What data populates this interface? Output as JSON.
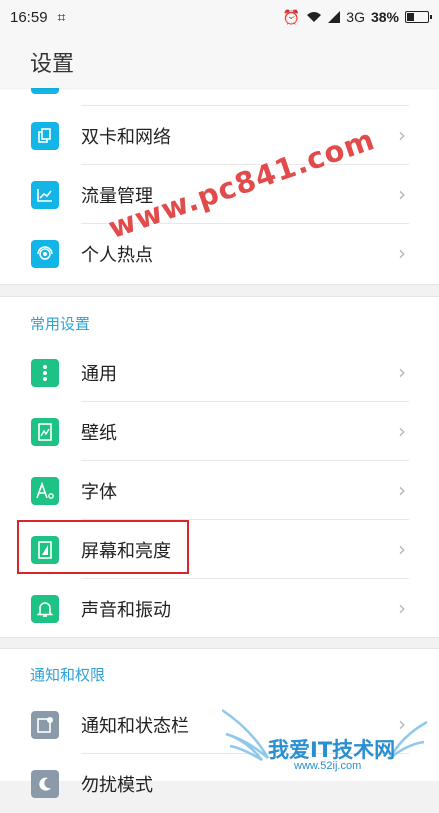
{
  "status_bar": {
    "time": "16:59",
    "network": "3G",
    "battery": "38%",
    "battery_level": 0.38
  },
  "header": {
    "title": "设置"
  },
  "group1": {
    "items": [
      {
        "label": "双卡和网络",
        "icon": "sim-card-icon"
      },
      {
        "label": "流量管理",
        "icon": "chart-icon"
      },
      {
        "label": "个人热点",
        "icon": "hotspot-icon"
      }
    ]
  },
  "group2": {
    "title": "常用设置",
    "items": [
      {
        "label": "通用",
        "icon": "more-vertical-icon"
      },
      {
        "label": "壁纸",
        "icon": "wallpaper-icon"
      },
      {
        "label": "字体",
        "icon": "font-icon"
      },
      {
        "label": "屏幕和亮度",
        "icon": "display-icon"
      },
      {
        "label": "声音和振动",
        "icon": "bell-icon"
      }
    ]
  },
  "group3": {
    "title": "通知和权限",
    "items": [
      {
        "label": "通知和状态栏",
        "icon": "notification-icon"
      },
      {
        "label": "勿扰模式",
        "icon": "moon-icon"
      }
    ]
  },
  "watermark": {
    "text": "www.pc841.com"
  },
  "logo": {
    "text": "我爱IT技术网",
    "url": "www.52ij.com"
  },
  "colors": {
    "accent": "#2fa1d8",
    "icon_blue": "#13b5e6",
    "icon_green": "#1fc285",
    "icon_gray": "#8a9aa8",
    "highlight": "#d9262c"
  }
}
